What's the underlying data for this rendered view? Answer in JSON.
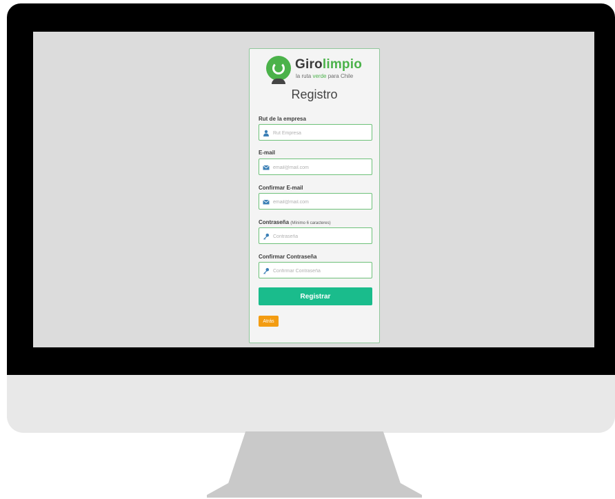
{
  "brand": {
    "name_part1": "Giro",
    "name_part2": "limpio",
    "tagline_part1": "la ruta",
    "tagline_part2": "verde",
    "tagline_part3": "para Chile",
    "color_green": "#4bb24a"
  },
  "form": {
    "title": "Registro",
    "fields": [
      {
        "label": "Rut de la empresa",
        "label_hint": "",
        "placeholder": "Rut Empresa",
        "icon": "user-icon"
      },
      {
        "label": "E-mail",
        "label_hint": "",
        "placeholder": "email@mail.com",
        "icon": "envelope-icon"
      },
      {
        "label": "Confirmar E-mail",
        "label_hint": "",
        "placeholder": "email@mail.com",
        "icon": "envelope-icon"
      },
      {
        "label": "Contraseña",
        "label_hint": "(Mínimo 6 caracteres)",
        "placeholder": "Contraseña",
        "icon": "key-icon"
      },
      {
        "label": "Confirmar Contraseña",
        "label_hint": "",
        "placeholder": "Confirmar Contraseña",
        "icon": "key-icon"
      }
    ],
    "submit_label": "Registrar",
    "back_label": "Atrás",
    "submit_color": "#1abc8c",
    "back_color": "#f39c12"
  }
}
